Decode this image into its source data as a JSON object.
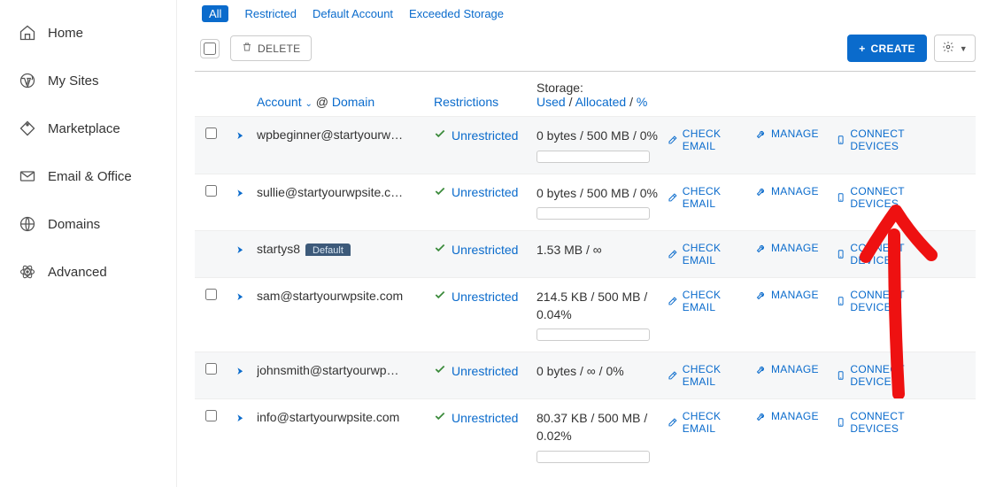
{
  "sidebar": {
    "items": [
      {
        "label": "Home"
      },
      {
        "label": "My Sites"
      },
      {
        "label": "Marketplace"
      },
      {
        "label": "Email & Office"
      },
      {
        "label": "Domains"
      },
      {
        "label": "Advanced"
      }
    ]
  },
  "filters": {
    "all": "All",
    "restricted": "Restricted",
    "default_account": "Default Account",
    "exceeded_storage": "Exceeded Storage"
  },
  "toolbar": {
    "delete_label": "DELETE",
    "create_label": "CREATE"
  },
  "columns": {
    "account": "Account",
    "at": "@",
    "domain": "Domain",
    "restrictions": "Restrictions",
    "storage": "Storage:",
    "used": "Used",
    "allocated": "Allocated",
    "percent": "%",
    "sep": "/"
  },
  "row_actions": {
    "check_email": "CHECK EMAIL",
    "manage": "MANAGE",
    "connect_devices": "CONNECT DEVICES"
  },
  "restriction_value": "Unrestricted",
  "default_badge": "Default",
  "accounts": [
    {
      "email": "wpbeginner@startyourw…",
      "storage": "0 bytes / 500 MB / 0%",
      "bar": true,
      "alt": true,
      "checkbox": true
    },
    {
      "email": "sullie@startyourwpsite.c…",
      "storage": "0 bytes / 500 MB / 0%",
      "bar": true,
      "alt": false,
      "checkbox": true
    },
    {
      "email": "startys8",
      "storage": "1.53 MB / ∞",
      "bar": false,
      "alt": true,
      "checkbox": false,
      "default": true
    },
    {
      "email": "sam@startyourwpsite.com",
      "storage": "214.5 KB / 500 MB / 0.04%",
      "bar": true,
      "alt": false,
      "checkbox": true
    },
    {
      "email": "johnsmith@startyourwp…",
      "storage": "0 bytes / ∞ / 0%",
      "bar": false,
      "alt": true,
      "checkbox": true
    },
    {
      "email": "info@startyourwpsite.com",
      "storage": "80.37 KB / 500 MB / 0.02%",
      "bar": true,
      "alt": false,
      "checkbox": true
    }
  ]
}
